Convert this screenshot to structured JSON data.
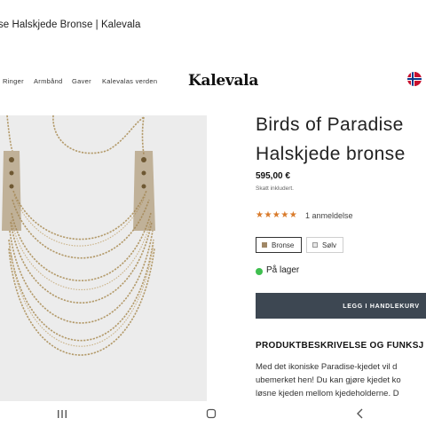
{
  "browser_tab": {
    "title": "se Halskjede Bronse | Kalevala"
  },
  "nav": {
    "items": [
      "Ringer",
      "Armbånd",
      "Gaver",
      "Kalevalas verden"
    ],
    "logo": "Kalevala",
    "flag_icon": "norway-flag-icon"
  },
  "product": {
    "title_line1": "Birds of Paradise",
    "title_line2": "Halskjede bronse",
    "price": "595,00 €",
    "tax_note": "Skatt inkludert.",
    "rating": 5,
    "stars": "★★★★★",
    "reviews": "1 anmeldelse",
    "variants": [
      {
        "label": "Bronse",
        "swatch": "#a08766",
        "selected": true
      },
      {
        "label": "Sølv",
        "swatch": "#e6e6e6",
        "selected": false
      }
    ],
    "stock": "På lager",
    "stock_color": "#3fbf4f",
    "cart_button": "LEGG I HANDLEKURV",
    "description_heading": "PRODUKTBESKRIVELSE OG FUNKSJ",
    "description_lines": [
      "Med det ikoniske Paradise-kjedet vil d",
      "ubemerket hen! Du kan gjøre kjedet ko",
      "løsne kjeden mellom kjedeholderne. D"
    ]
  },
  "colors": {
    "button_bg": "#3d4752",
    "star": "#d97a2a",
    "image_bg": "#ececec"
  },
  "system_nav": {
    "icons": [
      "recent-apps-icon",
      "home-icon",
      "back-icon"
    ]
  }
}
